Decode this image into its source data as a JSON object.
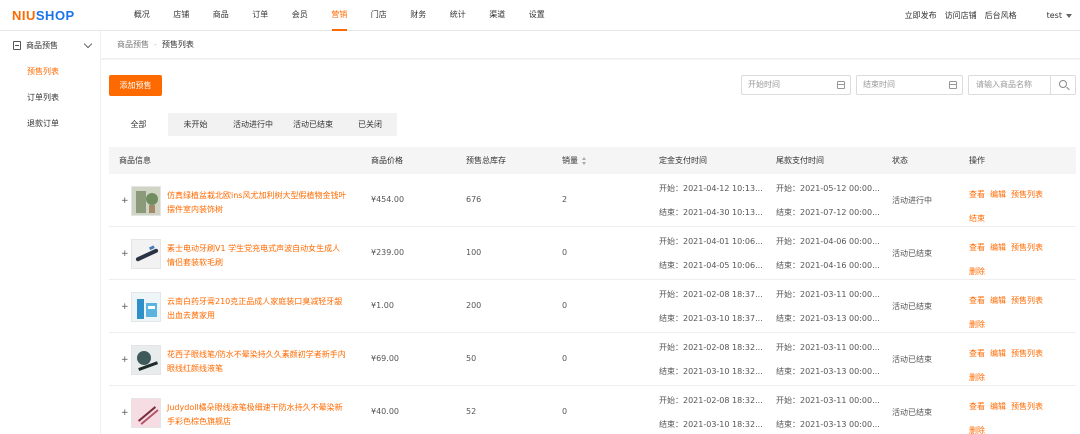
{
  "logo": {
    "part1": "NIU",
    "part2": "SHOP"
  },
  "nav": [
    "概况",
    "店铺",
    "商品",
    "订单",
    "会员",
    "营销",
    "门店",
    "财务",
    "统计",
    "渠道",
    "设置"
  ],
  "nav_active": "营销",
  "top_right": {
    "publish": "立即发布",
    "visit_store": "访问店铺",
    "admin_style": "后台风格",
    "user": "test"
  },
  "sidebar": {
    "group": "商品预售",
    "items": [
      "预售列表",
      "订单列表",
      "退款订单"
    ],
    "active": "预售列表"
  },
  "breadcrumb": {
    "parent": "商品预售",
    "separator": "-",
    "current": "预售列表"
  },
  "toolbar": {
    "add_label": "添加预售",
    "start_placeholder": "开始时间",
    "end_placeholder": "结束时间",
    "search_placeholder": "请输入商品名称"
  },
  "tabs": [
    "全部",
    "未开始",
    "活动进行中",
    "活动已结束",
    "已关闭"
  ],
  "active_tab": "全部",
  "columns": {
    "product": "商品信息",
    "price": "商品价格",
    "stock": "预售总库存",
    "sales": "销量",
    "deposit": "定金支付时间",
    "final": "尾款支付时间",
    "status": "状态",
    "ops": "操作"
  },
  "rows": [
    {
      "name": "仿真绿植盆栽北欧ins风尤加利树大型假植物金钱叶摆件室内装饰树",
      "price": "¥454.00",
      "stock": "676",
      "sales": "2",
      "dep_start": "开始：2021-04-12 10:13...",
      "dep_end": "结束：2021-04-30 10:13...",
      "fin_start": "开始：2021-05-12 00:00...",
      "fin_end": "结束：2021-07-12 00:00...",
      "status": "活动进行中",
      "ops": [
        "查看",
        "编辑",
        "预售列表",
        "结束"
      ]
    },
    {
      "name": "素士电动牙刷V1 学生党充电式声波自动女生成人情侣套装软毛刷",
      "price": "¥239.00",
      "stock": "100",
      "sales": "0",
      "dep_start": "开始：2021-04-01 10:06...",
      "dep_end": "结束：2021-04-05 10:06...",
      "fin_start": "开始：2021-04-06 00:00...",
      "fin_end": "结束：2021-04-16 00:00...",
      "status": "活动已结束",
      "ops": [
        "查看",
        "编辑",
        "预售列表",
        "删除"
      ]
    },
    {
      "name": "云南白药牙膏210克正品成人家庭装口臭减轻牙龈出血去黄家用",
      "price": "¥1.00",
      "stock": "200",
      "sales": "0",
      "dep_start": "开始：2021-02-08 18:37...",
      "dep_end": "结束：2021-03-10 18:37...",
      "fin_start": "开始：2021-03-11 00:00...",
      "fin_end": "结束：2021-03-13 00:00...",
      "status": "活动已结束",
      "ops": [
        "查看",
        "编辑",
        "预售列表",
        "删除"
      ]
    },
    {
      "name": "花西子眼线笔/防水不晕染持久久素颜初学者新手内眼线红颜线液笔",
      "price": "¥69.00",
      "stock": "50",
      "sales": "0",
      "dep_start": "开始：2021-02-08 18:32...",
      "dep_end": "结束：2021-03-10 18:32...",
      "fin_start": "开始：2021-03-11 00:00...",
      "fin_end": "结束：2021-03-13 00:00...",
      "status": "活动已结束",
      "ops": [
        "查看",
        "编辑",
        "预售列表",
        "删除"
      ]
    },
    {
      "name": "Judydoll橘朵眼线液笔极细速干防水持久不晕染新手彩色棕色旗舰店",
      "price": "¥40.00",
      "stock": "52",
      "sales": "0",
      "dep_start": "开始：2021-02-08 18:32...",
      "dep_end": "结束：2021-03-10 18:32...",
      "fin_start": "开始：2021-03-11 00:00...",
      "fin_end": "结束：2021-03-13 00:00...",
      "status": "活动已结束",
      "ops": [
        "查看",
        "编辑",
        "预售列表",
        "删除"
      ]
    }
  ]
}
